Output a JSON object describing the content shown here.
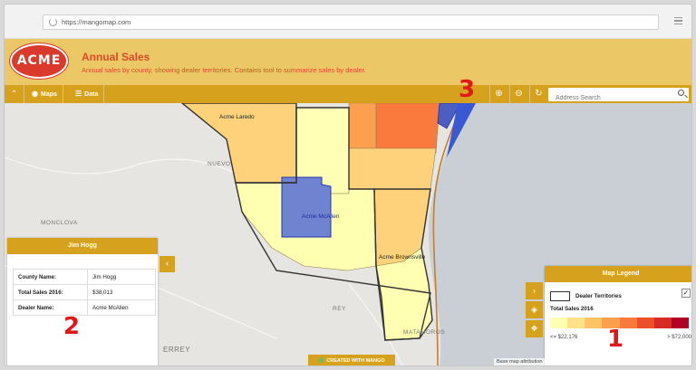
{
  "browser": {
    "url": "https://mangomap.com"
  },
  "app": {
    "logo_text": "ACME",
    "title": "Annual Sales",
    "subtitle": "Annual sales by county, showing dealer territories. Contains tool to summarize sales by dealer."
  },
  "toolbar": {
    "maps_label": "Maps",
    "data_label": "Data",
    "search_placeholder": "Address Search"
  },
  "map": {
    "territories": [
      "Acme Laredo",
      "Acme McAllen",
      "Acme Brownsville"
    ],
    "places": [
      "NUEVO",
      "MONCLOVA",
      "ERREY",
      "REY",
      "MATAMOROS"
    ],
    "attribution": "Base map attribution",
    "badge": "CREATED WITH MANGO"
  },
  "info_panel": {
    "title": "Jim Hogg",
    "rows": [
      {
        "key": "County Name:",
        "value": "Jim Hogg"
      },
      {
        "key": "Total Sales 2016:",
        "value": "$38,013"
      },
      {
        "key": "Dealer Name:",
        "value": "Acme McAllen"
      }
    ]
  },
  "legend": {
    "title": "Map Legend",
    "territories_label": "Dealer Territories",
    "sales_label": "Total Sales 2016",
    "min_label": "<= $22,176",
    "max_label": "> $72,000",
    "ramp_colors": [
      "#ffffb2",
      "#fde28a",
      "#fec465",
      "#fca050",
      "#f97a3c",
      "#ee4f2b",
      "#d72a24",
      "#b10026"
    ]
  },
  "annotations": {
    "a1": "1",
    "a2": "2",
    "a3": "3"
  }
}
